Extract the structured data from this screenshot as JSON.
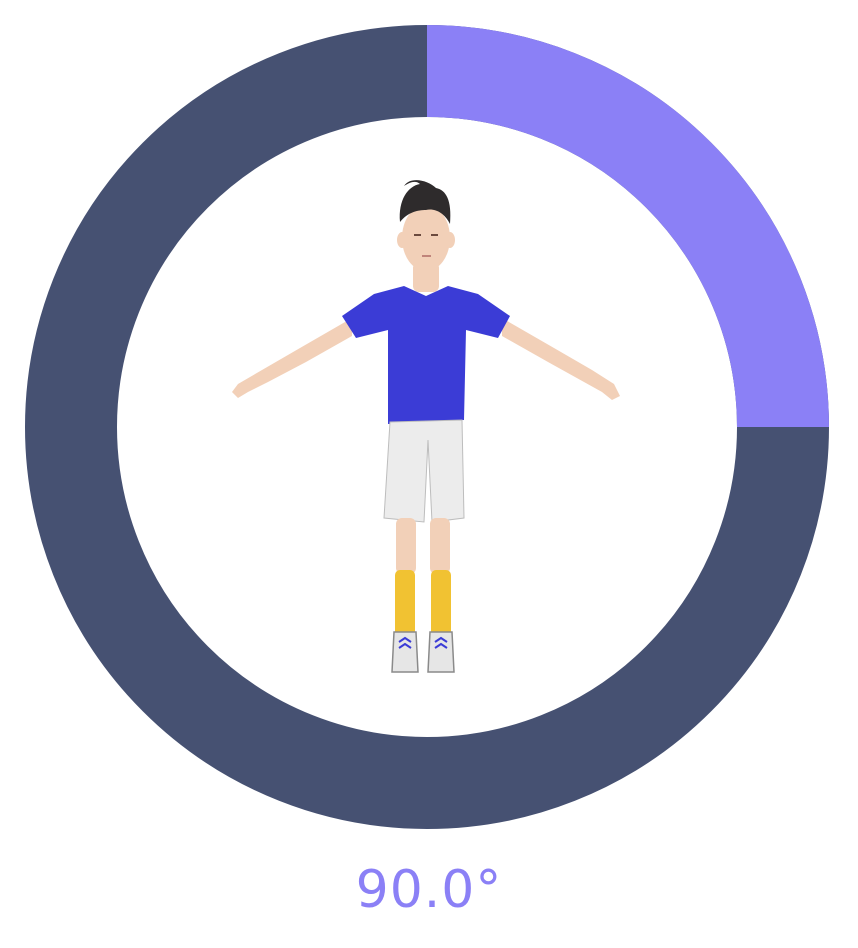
{
  "rotation": {
    "angle_degrees": 90.0,
    "angle_label": "90.0°",
    "max_degrees": 360
  },
  "colors": {
    "track": "#465172",
    "progress": "#8b80f6",
    "label": "#8b80f6",
    "shirt": "#3b3cd6",
    "shorts": "#ececec",
    "socks": "#f1c232",
    "skin": "#f2d0b8",
    "hair": "#2e2b2c"
  },
  "model": {
    "icon": "t-pose-character-icon"
  }
}
